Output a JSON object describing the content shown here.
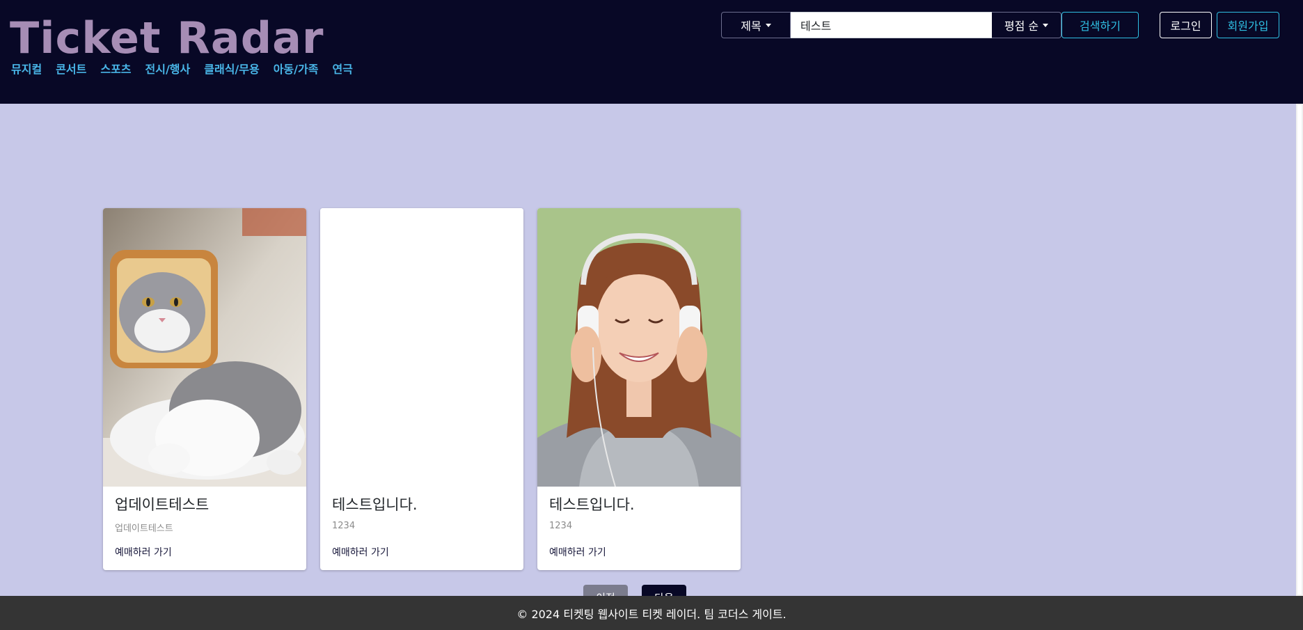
{
  "header": {
    "brand": "Ticket Radar",
    "nav": [
      "뮤지컬",
      "콘서트",
      "스포츠",
      "전시/행사",
      "클래식/무용",
      "아동/가족",
      "연극"
    ],
    "search": {
      "field_label": "제목",
      "query": "테스트",
      "sort_label": "평점 순",
      "search_label": "검색하기"
    },
    "login_label": "로그인",
    "signup_label": "회원가입"
  },
  "cards": [
    {
      "title": "업데이트테스트",
      "text": "업데이트테스트",
      "link": "예매하러 가기",
      "image": "cat-with-bread-photo"
    },
    {
      "title": "테스트입니다.",
      "text": "1234",
      "link": "예매하러 가기",
      "image": ""
    },
    {
      "title": "테스트입니다.",
      "text": "1234",
      "link": "예매하러 가기",
      "image": "woman-with-headphones-photo"
    }
  ],
  "pagination": {
    "prev_label": "이전",
    "next_label": "다음"
  },
  "footer": {
    "text": "© 2024 티켓팅 웹사이트 티켓 레이더. 팀 코더스 게이트."
  },
  "colors": {
    "header_bg": "#080826",
    "brand": "#a68db5",
    "nav_link": "#49b6e8",
    "accent": "#2fc1e4",
    "page_bg": "#c7c8e8",
    "footer_bg": "#343434"
  }
}
